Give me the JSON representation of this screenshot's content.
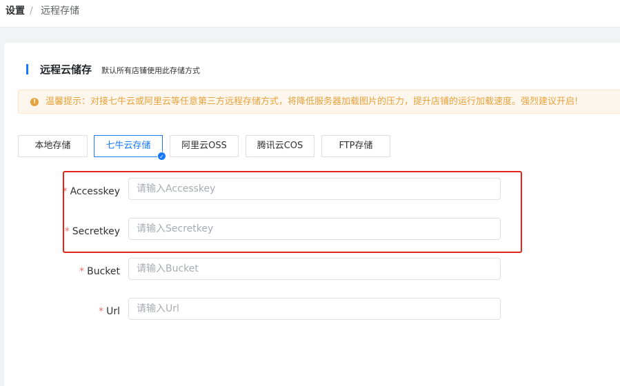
{
  "breadcrumb": {
    "root": "设置",
    "separator": "/",
    "current": "远程存储"
  },
  "section": {
    "title": "远程云储存",
    "subtitle": "默认所有店铺使用此存储方式"
  },
  "notice": {
    "icon": "warning-icon",
    "text": "温馨提示：对接七牛云或阿里云等任意第三方远程存储方式，将降低服务器加载图片的压力，提升店铺的运行加载速度。强烈建议开启!"
  },
  "tabs": [
    {
      "label": "本地存储",
      "active": false
    },
    {
      "label": "七牛云存储",
      "active": true
    },
    {
      "label": "阿里云OSS",
      "active": false
    },
    {
      "label": "腾讯云COS",
      "active": false
    },
    {
      "label": "FTP存储",
      "active": false
    }
  ],
  "form": {
    "required_mark": "*",
    "fields": [
      {
        "label": "Accesskey",
        "placeholder": "请输入Accesskey",
        "value": ""
      },
      {
        "label": "Secretkey",
        "placeholder": "请输入Secretkey",
        "value": ""
      },
      {
        "label": "Bucket",
        "placeholder": "请输入Bucket",
        "value": ""
      },
      {
        "label": "Url",
        "placeholder": "请输入Url",
        "value": ""
      }
    ]
  },
  "colors": {
    "accent": "#1677ff",
    "warning": "#e6a23c",
    "required": "#f56c6c",
    "highlight_border": "#e2231a"
  }
}
